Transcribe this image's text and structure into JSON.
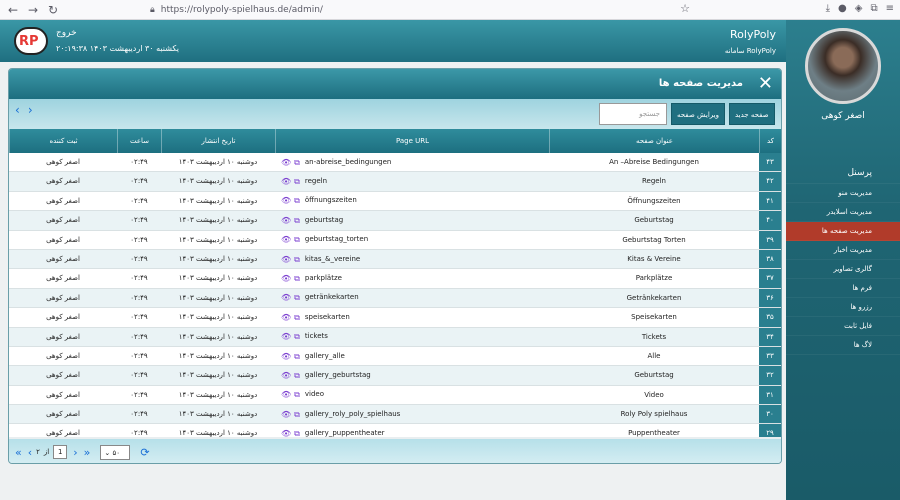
{
  "browser": {
    "url": "https://rolypoly-spielhaus.de/admin/"
  },
  "header": {
    "brand": "RolyPoly",
    "brand_sub": "سامانه RolyPoly",
    "exit": "خروج",
    "date": "یکشنبه ۳۰ اردیبهشت ۱۴۰۳ ۲۰:۱۹:۳۸",
    "logo": "RP"
  },
  "sidebar": {
    "user_name": "اصغر کوهی",
    "items": [
      {
        "label": "پرسنل"
      },
      {
        "label": "مدیریت منو"
      },
      {
        "label": "مدیریت اسلایدر"
      },
      {
        "label": "مدیریت صفحه ها"
      },
      {
        "label": "مدیریت اخبار"
      },
      {
        "label": "گالری تصاویر"
      },
      {
        "label": "فرم ها"
      },
      {
        "label": "رزرو ها"
      },
      {
        "label": "فایل ثابت"
      },
      {
        "label": "لاگ ها"
      }
    ],
    "active_index": 3
  },
  "panel": {
    "title": "مدیریت صفحه ها",
    "btn_new": "صفحه جدید",
    "btn_edit": "ویرایش صفحه",
    "search_placeholder": "جستجو"
  },
  "table": {
    "headers": {
      "code": "کد",
      "title": "عنوان صفحه",
      "url": "Page URL",
      "date": "تاریخ انتشار",
      "time": "ساعت",
      "by": "ثبت کننده"
    },
    "rows": [
      {
        "code": "۴۳",
        "title": "An –Abreise Bedingungen",
        "url": "an-abreise_bedingungen",
        "date": "دوشنبه ۱۰ اردیبهشت ۱۴۰۳",
        "time": "۰۲:۴۹",
        "by": "اصغر کوهی"
      },
      {
        "code": "۴۲",
        "title": "Regeln",
        "url": "regeln",
        "date": "دوشنبه ۱۰ اردیبهشت ۱۴۰۳",
        "time": "۰۲:۴۹",
        "by": "اصغر کوهی"
      },
      {
        "code": "۴۱",
        "title": "Öffnungszeiten",
        "url": "öffnungszeiten",
        "date": "دوشنبه ۱۰ اردیبهشت ۱۴۰۳",
        "time": "۰۲:۴۹",
        "by": "اصغر کوهی"
      },
      {
        "code": "۴۰",
        "title": "Geburtstag",
        "url": "geburtstag",
        "date": "دوشنبه ۱۰ اردیبهشت ۱۴۰۳",
        "time": "۰۲:۴۹",
        "by": "اصغر کوهی"
      },
      {
        "code": "۳۹",
        "title": "Geburtstag Torten",
        "url": "geburtstag_torten",
        "date": "دوشنبه ۱۰ اردیبهشت ۱۴۰۳",
        "time": "۰۲:۴۹",
        "by": "اصغر کوهی"
      },
      {
        "code": "۳۸",
        "title": "Kitas & Vereine",
        "url": "kitas_&_vereine",
        "date": "دوشنبه ۱۰ اردیبهشت ۱۴۰۳",
        "time": "۰۲:۴۹",
        "by": "اصغر کوهی"
      },
      {
        "code": "۳۷",
        "title": "Parkplätze",
        "url": "parkplätze",
        "date": "دوشنبه ۱۰ اردیبهشت ۱۴۰۳",
        "time": "۰۲:۴۹",
        "by": "اصغر کوهی"
      },
      {
        "code": "۳۶",
        "title": "Getränkekarten",
        "url": "getränkekarten",
        "date": "دوشنبه ۱۰ اردیبهشت ۱۴۰۳",
        "time": "۰۲:۴۹",
        "by": "اصغر کوهی"
      },
      {
        "code": "۳۵",
        "title": "Speisekarten",
        "url": "speisekarten",
        "date": "دوشنبه ۱۰ اردیبهشت ۱۴۰۳",
        "time": "۰۲:۴۹",
        "by": "اصغر کوهی"
      },
      {
        "code": "۳۴",
        "title": "Tickets",
        "url": "tickets",
        "date": "دوشنبه ۱۰ اردیبهشت ۱۴۰۳",
        "time": "۰۲:۴۹",
        "by": "اصغر کوهی"
      },
      {
        "code": "۳۳",
        "title": "Alle",
        "url": "gallery_alle",
        "date": "دوشنبه ۱۰ اردیبهشت ۱۴۰۳",
        "time": "۰۲:۴۹",
        "by": "اصغر کوهی"
      },
      {
        "code": "۳۲",
        "title": "Geburtstag",
        "url": "gallery_geburtstag",
        "date": "دوشنبه ۱۰ اردیبهشت ۱۴۰۳",
        "time": "۰۲:۴۹",
        "by": "اصغر کوهی"
      },
      {
        "code": "۳۱",
        "title": "Video",
        "url": "video",
        "date": "دوشنبه ۱۰ اردیبهشت ۱۴۰۳",
        "time": "۰۲:۴۹",
        "by": "اصغر کوهی"
      },
      {
        "code": "۳۰",
        "title": "Roly Poly spielhaus",
        "url": "gallery_roly_poly_spielhaus",
        "date": "دوشنبه ۱۰ اردیبهشت ۱۴۰۳",
        "time": "۰۲:۴۹",
        "by": "اصغر کوهی"
      },
      {
        "code": "۲۹",
        "title": "Puppentheater",
        "url": "gallery_puppentheater",
        "date": "دوشنبه ۱۰ اردیبهشت ۱۴۰۳",
        "time": "۰۲:۴۹",
        "by": "اصغر کوهی"
      }
    ]
  },
  "pager": {
    "page": "1",
    "of_label": "از",
    "total_pages": "۲",
    "page_size": "۵۰"
  }
}
